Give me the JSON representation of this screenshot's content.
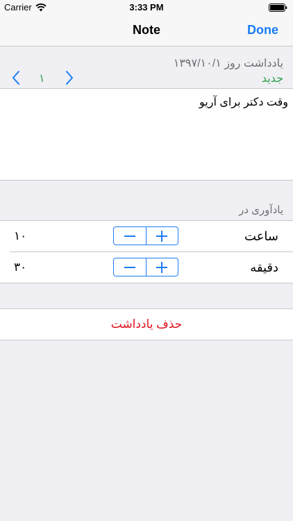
{
  "status_bar": {
    "carrier": "Carrier",
    "time": "3:33 PM"
  },
  "nav": {
    "title": "Note",
    "done_label": "Done"
  },
  "header": {
    "date_label": "یادداشت روز ۱۳۹۷/۱۰/۱",
    "new_label": "جدید",
    "page_number": "۱"
  },
  "note": {
    "text": "وقت دکتر برای آریو"
  },
  "reminder": {
    "section_label": "یادآوری در",
    "hour": {
      "label": "ساعت",
      "value": "۱۰"
    },
    "minute": {
      "label": "دقیقه",
      "value": "۳۰"
    }
  },
  "delete": {
    "label": "حذف یادداشت"
  },
  "colors": {
    "accent": "#1a7cf5",
    "green": "#2ea14b",
    "destructive": "#e0111c"
  },
  "icons": [
    "wifi-icon",
    "battery-icon",
    "chevron-left-icon",
    "chevron-right-icon",
    "minus-icon",
    "plus-icon"
  ]
}
